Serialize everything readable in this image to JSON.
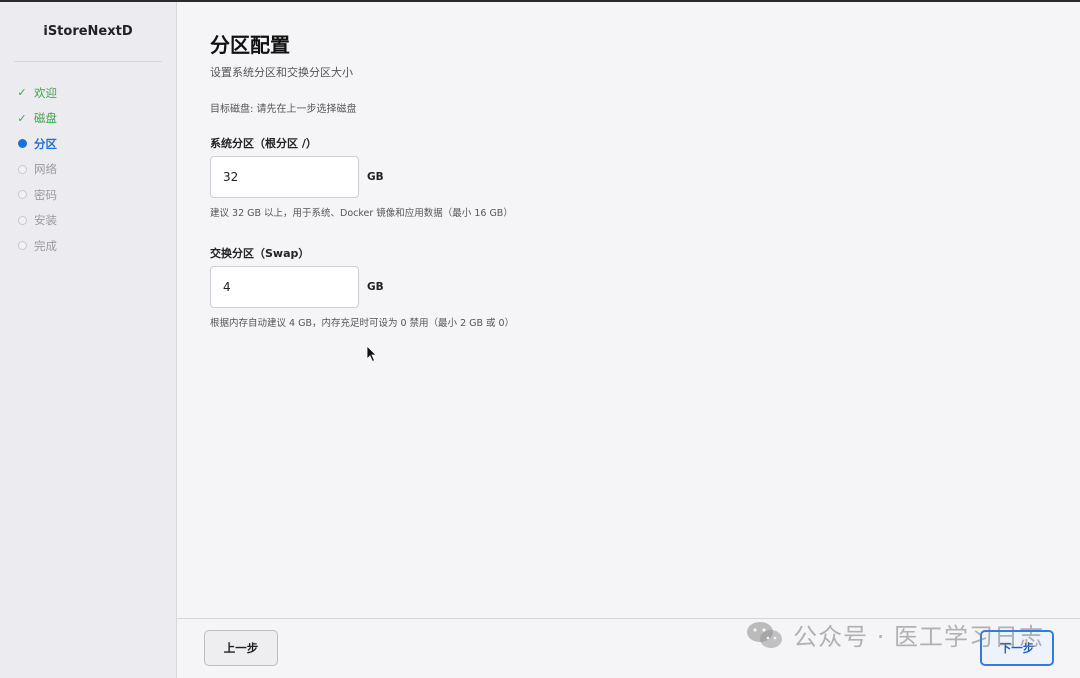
{
  "sidebar": {
    "brand": "iStoreNextD",
    "steps": [
      {
        "label": "欢迎",
        "status": "done"
      },
      {
        "label": "磁盘",
        "status": "done"
      },
      {
        "label": "分区",
        "status": "current"
      },
      {
        "label": "网络",
        "status": "pending"
      },
      {
        "label": "密码",
        "status": "pending"
      },
      {
        "label": "安装",
        "status": "pending"
      },
      {
        "label": "完成",
        "status": "pending"
      }
    ]
  },
  "page": {
    "title": "分区配置",
    "subtitle": "设置系统分区和交换分区大小",
    "target_disk": "目标磁盘: 请先在上一步选择磁盘"
  },
  "fields": {
    "system": {
      "label": "系统分区（根分区 /）",
      "value": "32",
      "unit": "GB",
      "hint": "建议 32 GB 以上，用于系统、Docker 镜像和应用数据（最小 16 GB）"
    },
    "swap": {
      "label": "交换分区（Swap）",
      "value": "4",
      "unit": "GB",
      "hint": "根据内存自动建议 4 GB，内存充足时可设为 0 禁用（最小 2 GB 或 0）"
    }
  },
  "footer": {
    "prev_label": "上一步",
    "next_label": "下一步"
  },
  "watermark": {
    "text": "公众号 · 医工学习日志"
  },
  "colors": {
    "done": "#3fa34d",
    "current": "#1e6fd9",
    "pending": "#9a9aa0",
    "accent": "#2f7de1"
  }
}
